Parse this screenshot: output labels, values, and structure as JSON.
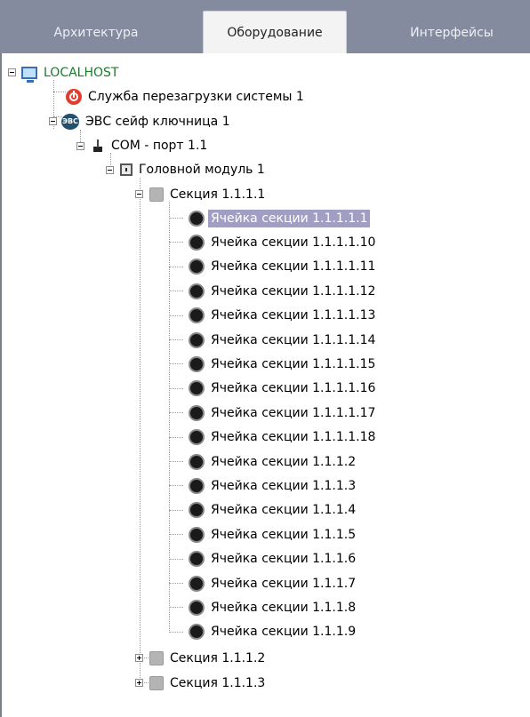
{
  "tabs": [
    {
      "label": "Архитектура",
      "active": false
    },
    {
      "label": "Оборудование",
      "active": true
    },
    {
      "label": "Интерфейсы",
      "active": false
    }
  ],
  "tree": {
    "root": {
      "label": "LOCALHOST",
      "icon": "monitor-icon"
    },
    "reboot_service": {
      "label": "Служба перезагрузки системы 1",
      "icon": "power-icon"
    },
    "evs": {
      "label": "ЭВС сейф ключница 1",
      "icon": "evs-icon",
      "icon_text": "ЭВС"
    },
    "com_port": {
      "label": "COM - порт 1.1",
      "icon": "com-port-icon"
    },
    "head_module": {
      "label": "Головной модуль 1",
      "icon": "module-icon"
    },
    "sections": [
      {
        "label": "Секция 1.1.1.1",
        "expanded": true
      },
      {
        "label": "Секция 1.1.1.2",
        "expanded": false
      },
      {
        "label": "Секция 1.1.1.3",
        "expanded": false
      }
    ],
    "cells": [
      "Ячейка секции 1.1.1.1.1",
      "Ячейка секции 1.1.1.1.10",
      "Ячейка секции 1.1.1.1.11",
      "Ячейка секции 1.1.1.1.12",
      "Ячейка секции 1.1.1.1.13",
      "Ячейка секции 1.1.1.1.14",
      "Ячейка секции 1.1.1.1.15",
      "Ячейка секции 1.1.1.1.16",
      "Ячейка секции 1.1.1.1.17",
      "Ячейка секции 1.1.1.1.18",
      "Ячейка секции 1.1.1.2",
      "Ячейка секции 1.1.1.3",
      "Ячейка секции 1.1.1.4",
      "Ячейка секции 1.1.1.5",
      "Ячейка секции 1.1.1.6",
      "Ячейка секции 1.1.1.7",
      "Ячейка секции 1.1.1.8",
      "Ячейка секции 1.1.1.9"
    ],
    "selected_cell": "Ячейка секции 1.1.1.1.1"
  },
  "colors": {
    "tabbar": "#848b9f",
    "selection": "#a09ec2",
    "root_label": "#1d7a2c"
  }
}
